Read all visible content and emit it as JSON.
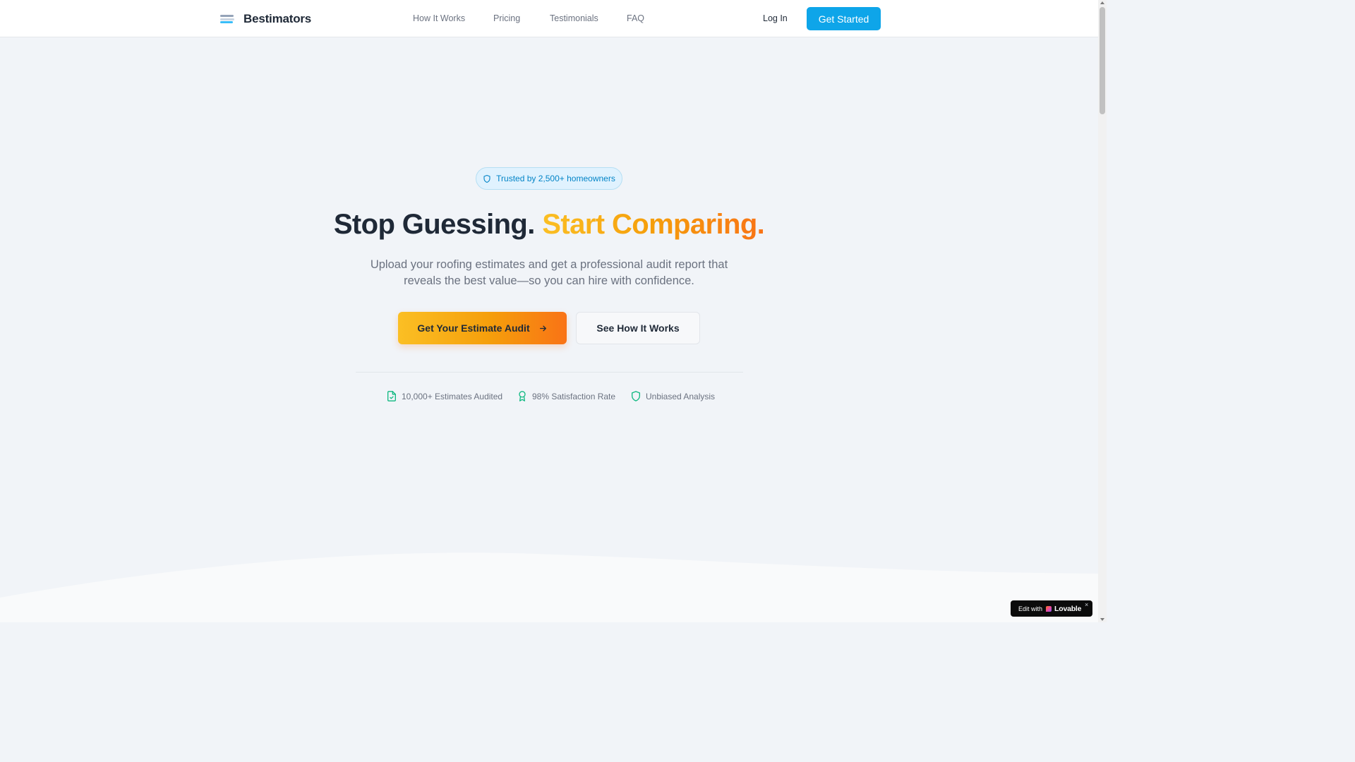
{
  "header": {
    "brand": "Bestimators",
    "nav": [
      {
        "label": "How It Works"
      },
      {
        "label": "Pricing"
      },
      {
        "label": "Testimonials"
      },
      {
        "label": "FAQ"
      }
    ],
    "login_label": "Log In",
    "cta_label": "Get Started"
  },
  "hero": {
    "badge": "Trusted by 2,500+ homeowners",
    "headline_dark": "Stop Guessing.",
    "headline_accent": "Start Comparing.",
    "subtext": "Upload your roofing estimates and get a professional audit report that reveals the best value—so you can hire with confidence.",
    "primary_cta": "Get Your Estimate Audit",
    "secondary_cta": "See How It Works",
    "stats": [
      {
        "label": "10,000+ Estimates Audited",
        "icon": "file-check-icon"
      },
      {
        "label": "98% Satisfaction Rate",
        "icon": "award-icon"
      },
      {
        "label": "Unbiased Analysis",
        "icon": "shield-icon"
      }
    ]
  },
  "widget": {
    "prefix": "Edit with",
    "brand": "Lovable",
    "close": "×"
  },
  "colors": {
    "primary": "#0ea5e9",
    "accent_start": "#fbbf24",
    "accent_end": "#f97316",
    "stat_icon": "#10b981"
  }
}
